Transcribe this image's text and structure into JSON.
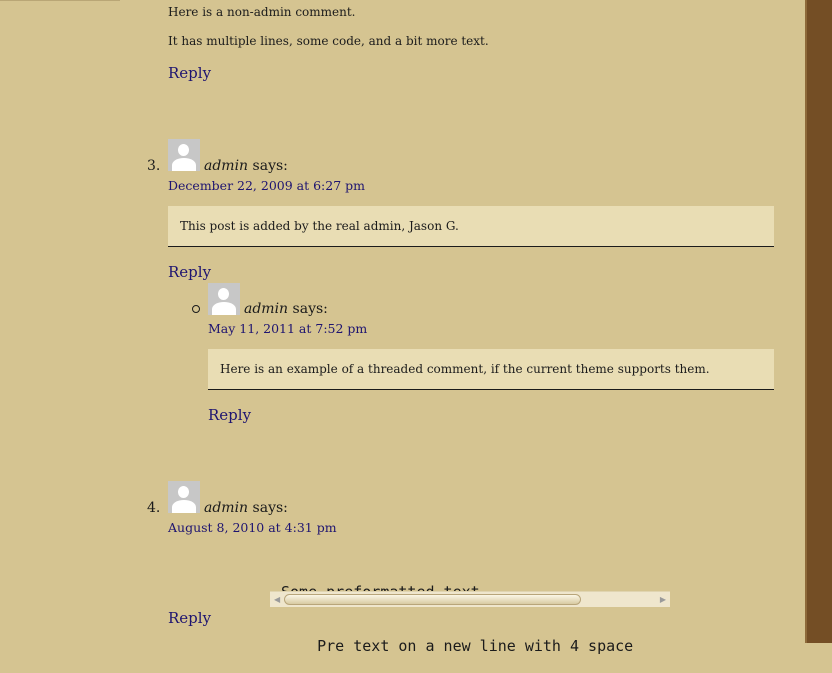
{
  "comments": {
    "c2": {
      "line1": "Here is a non-admin comment.",
      "line2": "It has multiple lines, some code, and a bit more text.",
      "reply": "Reply"
    },
    "c3": {
      "number": "3.",
      "author": "admin",
      "says": "says:",
      "date": "December 22, 2009 at 6:27 pm",
      "body": "This post is added by the real admin, Jason G.",
      "reply": "Reply",
      "child": {
        "author": "admin",
        "says": "says:",
        "date": "May 11, 2011 at 7:52 pm",
        "body": "Here is an example of a threaded comment, if the current theme supports them.",
        "reply": "Reply"
      }
    },
    "c4": {
      "number": "4.",
      "author": "admin",
      "says": "says:",
      "date": "August 8, 2010 at 4:31 pm",
      "pre_line1": "Some preformatted text.",
      "pre_line2": "    Pre text on a new line with 4 space",
      "reply": "Reply"
    }
  },
  "icons": {
    "avatar": "default-user-avatar-icon",
    "scroll_left": "arrow-left-icon",
    "scroll_right": "arrow-right-icon"
  },
  "colors": {
    "background": "#d5c491",
    "sidebar": "#744e25",
    "link": "#1e1470",
    "quote_box": "#e9ddb4"
  }
}
